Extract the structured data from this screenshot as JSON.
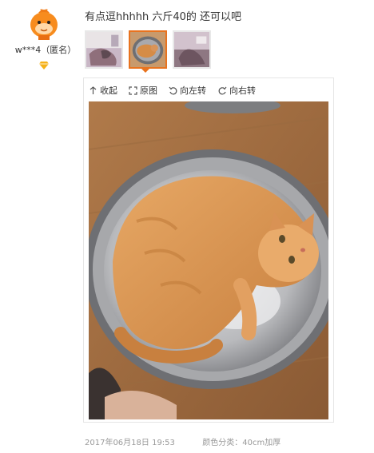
{
  "review": {
    "user": {
      "name": "w***4（匿名）",
      "avatar_icon": "orange-cartoon-avatar",
      "badge_icon": "diamond-icon"
    },
    "comment": "有点逗hhhhh 六斤40的 还可以吧",
    "thumbnails": [
      {
        "icon": "cat-photo-thumb-1",
        "active": false
      },
      {
        "icon": "cat-photo-thumb-2",
        "active": true
      },
      {
        "icon": "cat-photo-thumb-3",
        "active": false
      }
    ],
    "toolbar": {
      "collapse": "收起",
      "original": "原图",
      "rotate_left": "向左转",
      "rotate_right": "向右转"
    },
    "date": "2017年06月18日 19:53",
    "spec": "颜色分类：40cm加厚"
  },
  "colors": {
    "accent": "#e8731f",
    "muted": "#999999"
  }
}
